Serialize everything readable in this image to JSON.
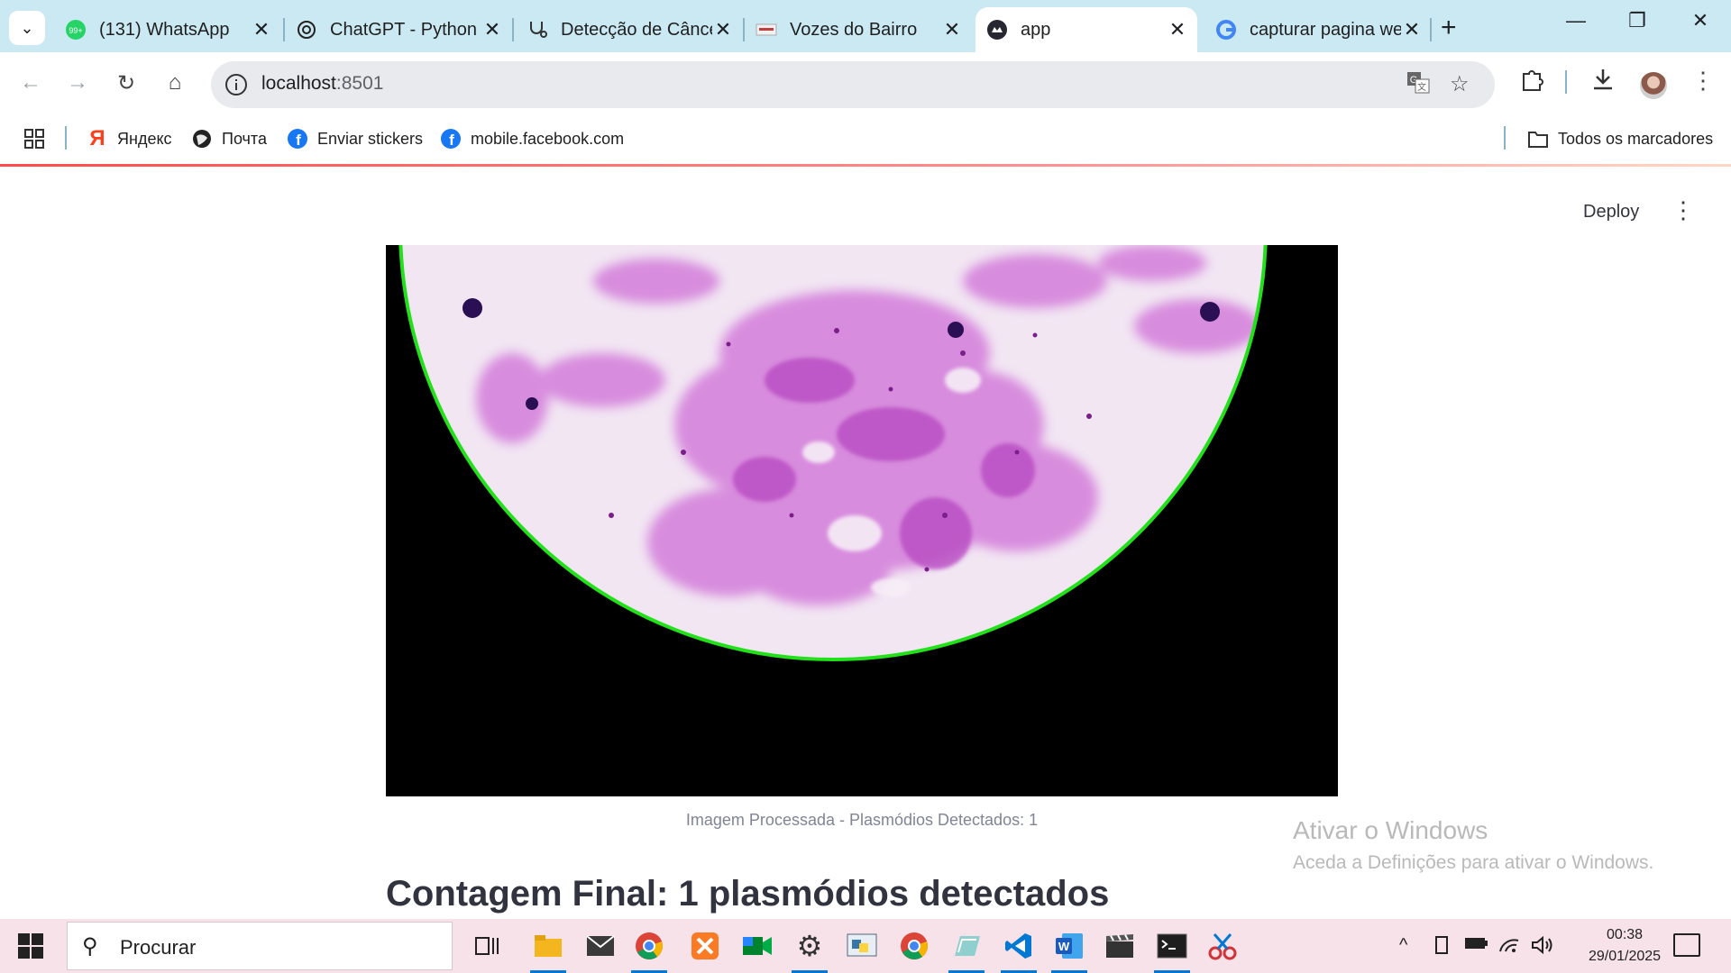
{
  "browser": {
    "tabs": [
      {
        "title": "(131) WhatsApp",
        "icon": "whatsapp-icon"
      },
      {
        "title": "ChatGPT - Python",
        "icon": "chatgpt-icon"
      },
      {
        "title": "Detecção de Câncer",
        "icon": "stethoscope-icon"
      },
      {
        "title": "Vozes do Bairro",
        "icon": "site-icon"
      },
      {
        "title": "app",
        "icon": "streamlit-icon",
        "active": true
      },
      {
        "title": "capturar pagina web",
        "icon": "google-icon"
      }
    ],
    "url_host": "localhost",
    "url_port": ":8501",
    "bookmarks": [
      {
        "label": "Яндекс",
        "icon": "yandex-icon"
      },
      {
        "label": "Почта",
        "icon": "globe-icon"
      },
      {
        "label": "Enviar stickers",
        "icon": "facebook-icon"
      },
      {
        "label": "mobile.facebook.com",
        "icon": "facebook-icon"
      }
    ],
    "all_bookmarks": "Todos os marcadores"
  },
  "app": {
    "deploy_label": "Deploy",
    "caption": "Imagem Processada - Plasmódios Detectados: 1",
    "final_count": "Contagem Final: 1 plasmódios detectados"
  },
  "watermark": {
    "line1": "Ativar o Windows",
    "line2": "Aceda a Definições para ativar o Windows."
  },
  "taskbar": {
    "search_placeholder": "Procurar",
    "time": "00:38",
    "date": "29/01/2025"
  },
  "colors": {
    "tabstrip": "#cbe9f3",
    "detection_ring": "#22e01a",
    "stain": "#c04fc8",
    "taskbar": "#f6e2e8"
  }
}
